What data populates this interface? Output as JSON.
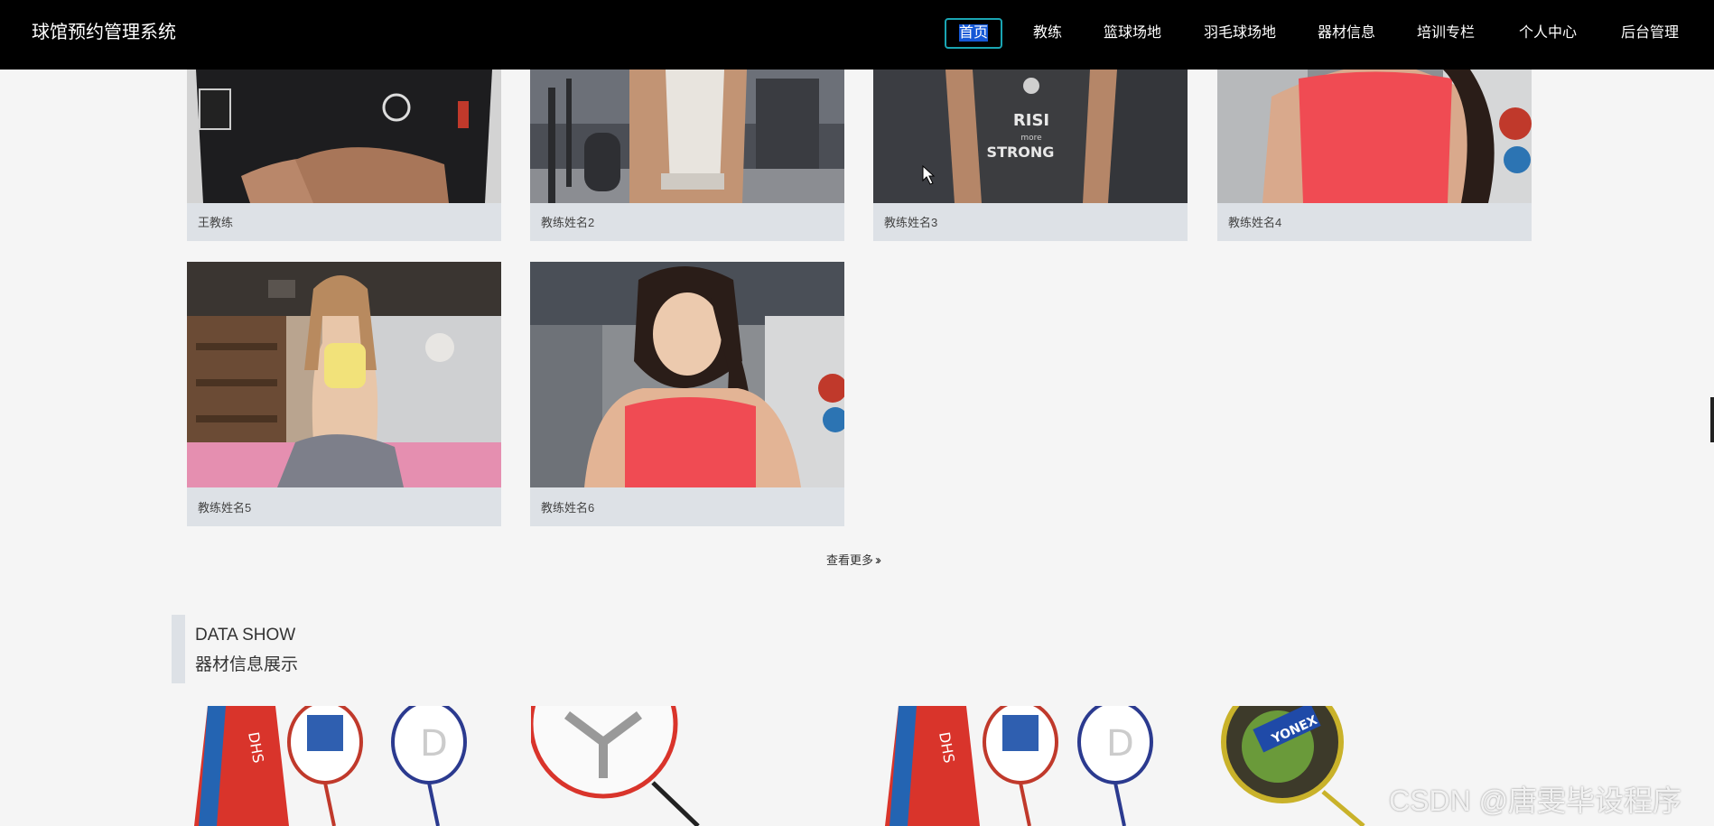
{
  "header": {
    "brand": "球馆预约管理系统",
    "nav": [
      {
        "label": "首页",
        "active": true
      },
      {
        "label": "教练"
      },
      {
        "label": "篮球场地"
      },
      {
        "label": "羽毛球场地"
      },
      {
        "label": "器材信息"
      },
      {
        "label": "培训专栏"
      },
      {
        "label": "个人中心"
      },
      {
        "label": "后台管理"
      }
    ]
  },
  "coaches": {
    "items": [
      {
        "name": "王教练",
        "photo": "coach-black-tshirt-photo"
      },
      {
        "name": "教练姓名2",
        "photo": "coach-gym-flex-photo"
      },
      {
        "name": "教练姓名3",
        "photo": "coach-strong-tank-photo"
      },
      {
        "name": "教练姓名4",
        "photo": "coach-red-top-photo"
      },
      {
        "name": "教练姓名5",
        "photo": "coach-yoga-photo"
      },
      {
        "name": "教练姓名6",
        "photo": "coach-red-top-smile-photo"
      }
    ],
    "more": "查看更多",
    "more_icon": "double-chevron-right-icon"
  },
  "equipment_section": {
    "title_en": "DATA SHOW",
    "title_cn": "器材信息展示",
    "items": [
      {
        "photo": "dhs-racket-set-photo"
      },
      {
        "photo": "single-racket-photo"
      },
      {
        "photo": "dhs-racket-set-photo"
      },
      {
        "photo": "yonex-racket-photo"
      }
    ]
  },
  "watermark": "CSDN @唐雯毕设程序",
  "colors": {
    "topbar": "#000000",
    "page_bg": "#f5f5f5",
    "card_bg": "#dde1e6",
    "active_border": "#1aa5b3"
  }
}
